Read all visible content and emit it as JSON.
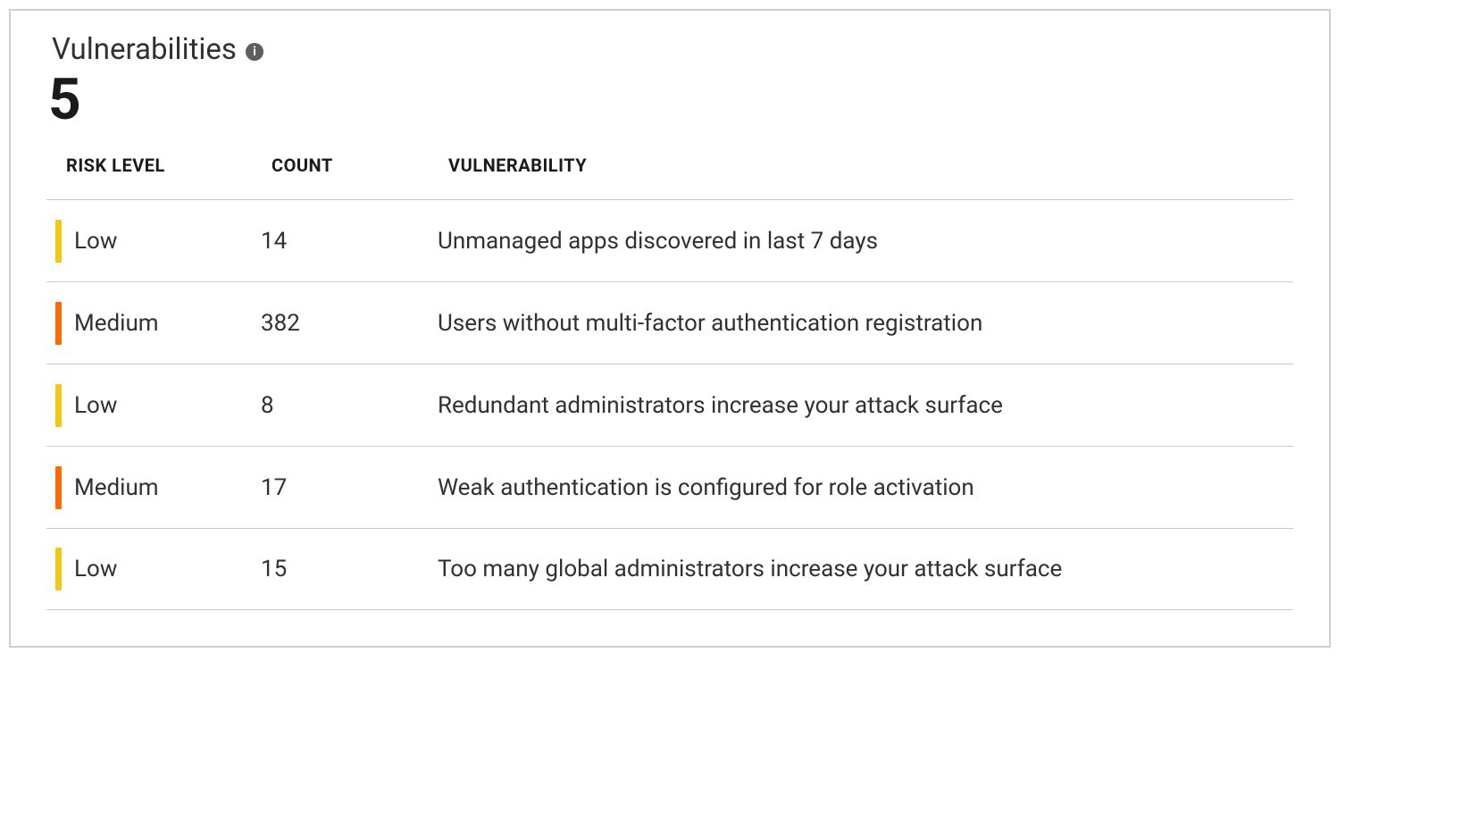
{
  "tile": {
    "title": "Vulnerabilities",
    "info_glyph": "i",
    "total_count": "5"
  },
  "table": {
    "headers": {
      "risk_level": "RISK LEVEL",
      "count": "COUNT",
      "vulnerability": "VULNERABILITY"
    },
    "rows": [
      {
        "risk_label": "Low",
        "risk_color": "#f2c811",
        "count": "14",
        "vulnerability": "Unmanaged apps discovered in last 7 days"
      },
      {
        "risk_label": "Medium",
        "risk_color": "#ff6a00",
        "count": "382",
        "vulnerability": "Users without multi-factor authentication registration"
      },
      {
        "risk_label": "Low",
        "risk_color": "#f2c811",
        "count": "8",
        "vulnerability": "Redundant administrators increase your attack surface"
      },
      {
        "risk_label": "Medium",
        "risk_color": "#ff6a00",
        "count": "17",
        "vulnerability": "Weak authentication is configured for role activation"
      },
      {
        "risk_label": "Low",
        "risk_color": "#f2c811",
        "count": "15",
        "vulnerability": "Too many global administrators increase your attack surface"
      }
    ]
  }
}
